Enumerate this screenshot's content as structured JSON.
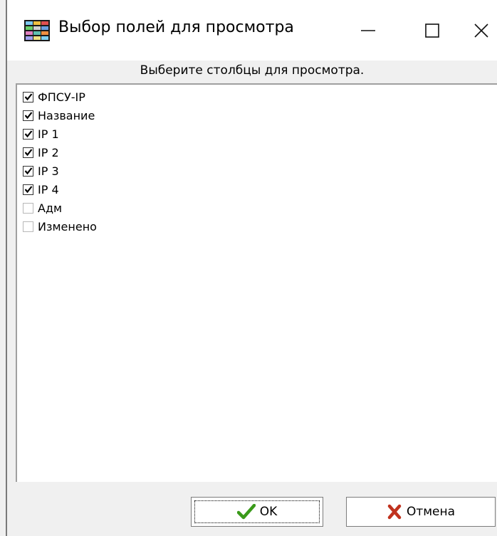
{
  "window": {
    "title": "Выбор полей для просмотра",
    "icon": "table-columns-icon",
    "controls": {
      "minimize": "minimize-icon",
      "maximize": "maximize-icon",
      "close": "close-icon"
    }
  },
  "header": {
    "text": "Выберите столбцы для просмотра."
  },
  "fields": [
    {
      "label": "ФПСУ-IP",
      "checked": true
    },
    {
      "label": "Название",
      "checked": true
    },
    {
      "label": "IP 1",
      "checked": true
    },
    {
      "label": "IP 2",
      "checked": true
    },
    {
      "label": "IP 3",
      "checked": true
    },
    {
      "label": "IP 4",
      "checked": true
    },
    {
      "label": "Адм",
      "checked": false
    },
    {
      "label": "Изменено",
      "checked": false
    }
  ],
  "buttons": {
    "ok": {
      "label": "OK",
      "icon": "checkmark-icon",
      "icon_color": "#3a9a1a"
    },
    "cancel": {
      "label": "Отмена",
      "icon": "cross-icon",
      "icon_color": "#c0321e"
    }
  }
}
